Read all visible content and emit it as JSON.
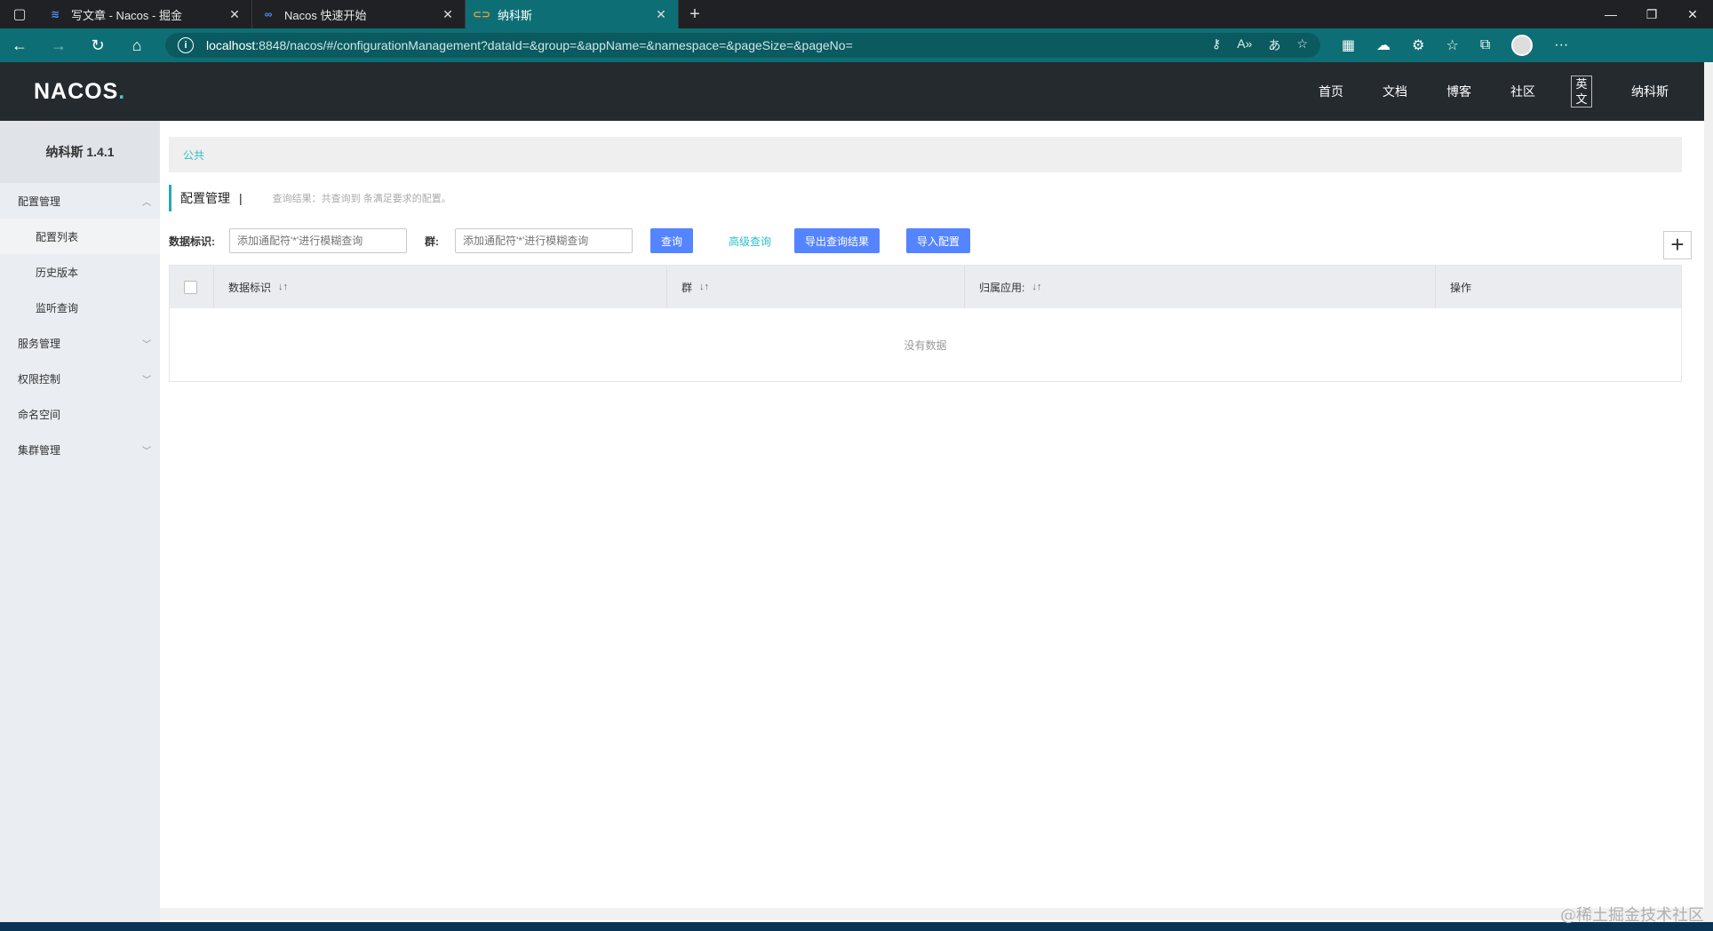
{
  "browser": {
    "tabs": [
      {
        "title": "写文章 - Nacos - 掘金",
        "icon": "juejin-icon"
      },
      {
        "title": "Nacos 快速开始",
        "icon": "nacos-icon"
      },
      {
        "title": "纳科斯",
        "icon": "nacos-icon",
        "active": true
      }
    ],
    "url_host": "localhost",
    "url_path": ":8848/nacos/#/configurationManagement?dataId=&group=&appName=&namespace=&pageSize=&pageNo=",
    "colors": {
      "toolbar": "#0d6f75",
      "tabbar": "#202124"
    }
  },
  "header": {
    "logo": "NACOS",
    "logo_dot": ".",
    "nav": [
      "首页",
      "文档",
      "博客",
      "社区"
    ],
    "lang": "英文",
    "brand": "纳科斯"
  },
  "sidebar": {
    "title": "纳科斯 1.4.1",
    "groups": [
      {
        "label": "配置管理",
        "children": [
          "配置列表",
          "历史版本",
          "监听查询"
        ]
      },
      {
        "label": "服务管理"
      },
      {
        "label": "权限控制"
      },
      {
        "label": "命名空间"
      },
      {
        "label": "集群管理"
      }
    ]
  },
  "main": {
    "namespace": "公共",
    "page_title": "配置管理",
    "title_sep": "|",
    "query_result": "查询结果：共查询到 条满足要求的配置。",
    "search": {
      "dataid_label": "数据标识:",
      "dataid_placeholder": "添加通配符'*'进行模糊查询",
      "group_label": "群:",
      "group_placeholder": "添加通配符'*'进行模糊查询",
      "query_btn": "查询",
      "advanced_btn": "高级查询",
      "export_btn": "导出查询结果",
      "import_btn": "导入配置",
      "add_btn": "+"
    },
    "table": {
      "columns": [
        "数据标识",
        "群",
        "归属应用:",
        "操作"
      ],
      "empty": "没有数据"
    }
  },
  "watermark": "@稀土掘金技术社区"
}
